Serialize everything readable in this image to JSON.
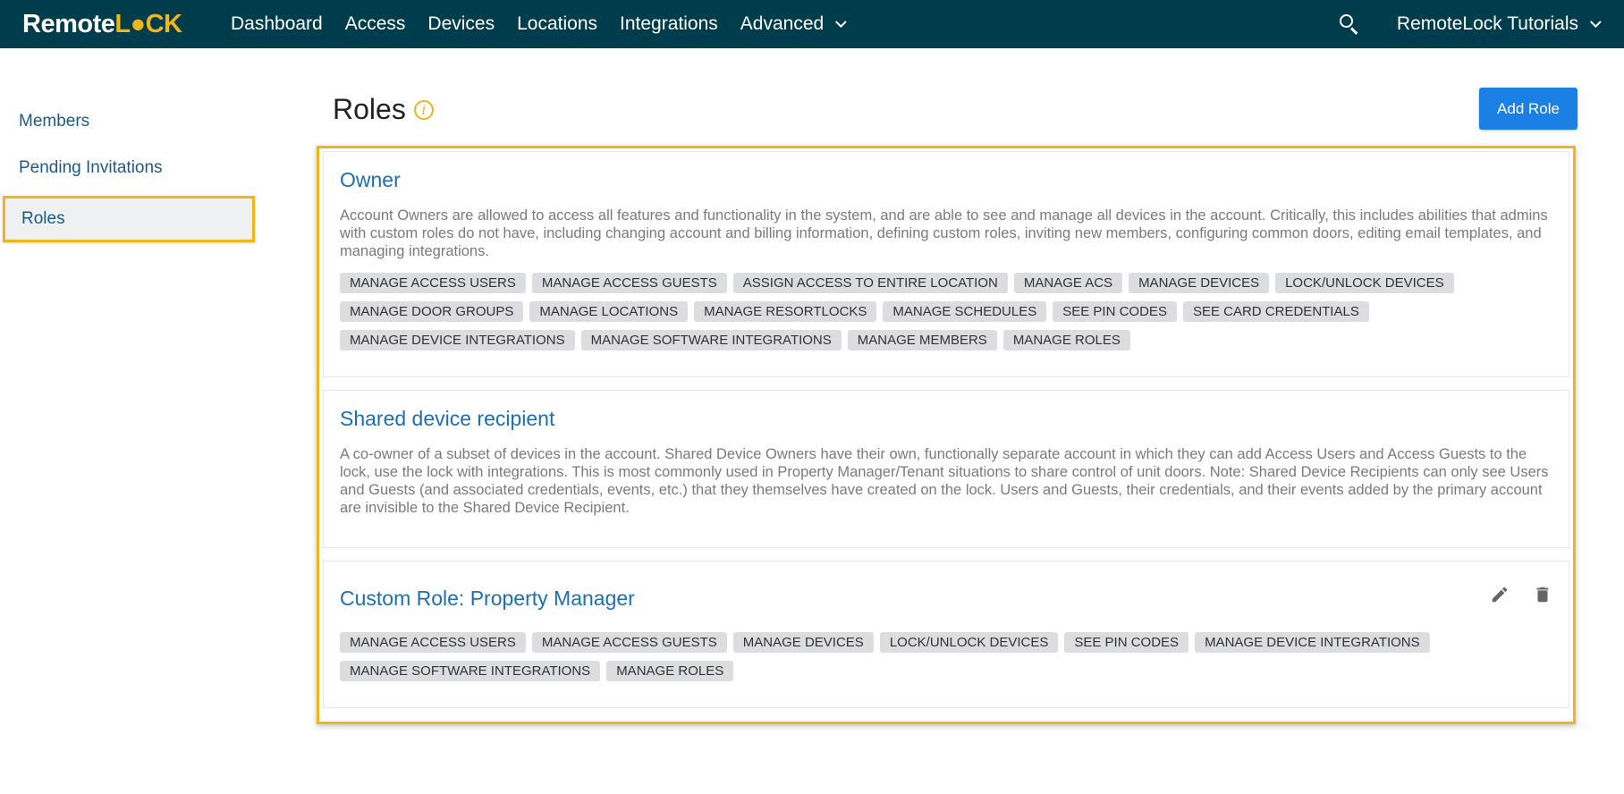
{
  "nav": {
    "logo_pre": "Remote",
    "logo_accent": "L●CK",
    "links": [
      "Dashboard",
      "Access",
      "Devices",
      "Locations",
      "Integrations",
      "Advanced"
    ],
    "account": "RemoteLock Tutorials",
    "icons": {
      "search": "search-icon",
      "dropdown": "chevron-down-icon"
    }
  },
  "sidebar": {
    "items": [
      "Members",
      "Pending Invitations",
      "Roles"
    ],
    "active": "Roles"
  },
  "header": {
    "title": "Roles",
    "info_glyph": "i",
    "add_button": "Add Role"
  },
  "roles": [
    {
      "title": "Owner",
      "description": "Account Owners are allowed to access all features and functionality in the system, and are able to see and manage all devices in the account. Critically, this includes abilities that admins with custom roles do not have, including changing account and billing information, defining custom roles, inviting new members, configuring common doors, editing email templates, and managing integrations.",
      "tags": [
        "MANAGE ACCESS USERS",
        "MANAGE ACCESS GUESTS",
        "ASSIGN ACCESS TO ENTIRE LOCATION",
        "MANAGE ACS",
        "MANAGE DEVICES",
        "LOCK/UNLOCK DEVICES",
        "MANAGE DOOR GROUPS",
        "MANAGE LOCATIONS",
        "MANAGE RESORTLOCKS",
        "MANAGE SCHEDULES",
        "SEE PIN CODES",
        "SEE CARD CREDENTIALS",
        "MANAGE DEVICE INTEGRATIONS",
        "MANAGE SOFTWARE INTEGRATIONS",
        "MANAGE MEMBERS",
        "MANAGE ROLES"
      ]
    },
    {
      "title": "Shared device recipient",
      "description": "A co-owner of a subset of devices in the account. Shared Device Owners have their own, functionally separate account in which they can add Access Users and Access Guests to the lock, use the lock with integrations. This is most commonly used in Property Manager/Tenant situations to share control of unit doors. Note: Shared Device Recipients can only see Users and Guests (and associated credentials, events, etc.) that they themselves have created on the lock. Users and Guests, their credentials, and their events added by the primary account are invisible to the Shared Device Recipient."
    },
    {
      "title": "Custom Role: Property Manager",
      "tags": [
        "MANAGE ACCESS USERS",
        "MANAGE ACCESS GUESTS",
        "MANAGE DEVICES",
        "LOCK/UNLOCK DEVICES",
        "SEE PIN CODES",
        "MANAGE DEVICE INTEGRATIONS",
        "MANAGE SOFTWARE INTEGRATIONS",
        "MANAGE ROLES"
      ],
      "actions": [
        "edit-icon",
        "trash-icon"
      ]
    }
  ],
  "colors": {
    "nav_bg": "#003d4c",
    "accent": "#f1b51c",
    "link": "#1b6fb2",
    "button": "#1a80e5"
  }
}
